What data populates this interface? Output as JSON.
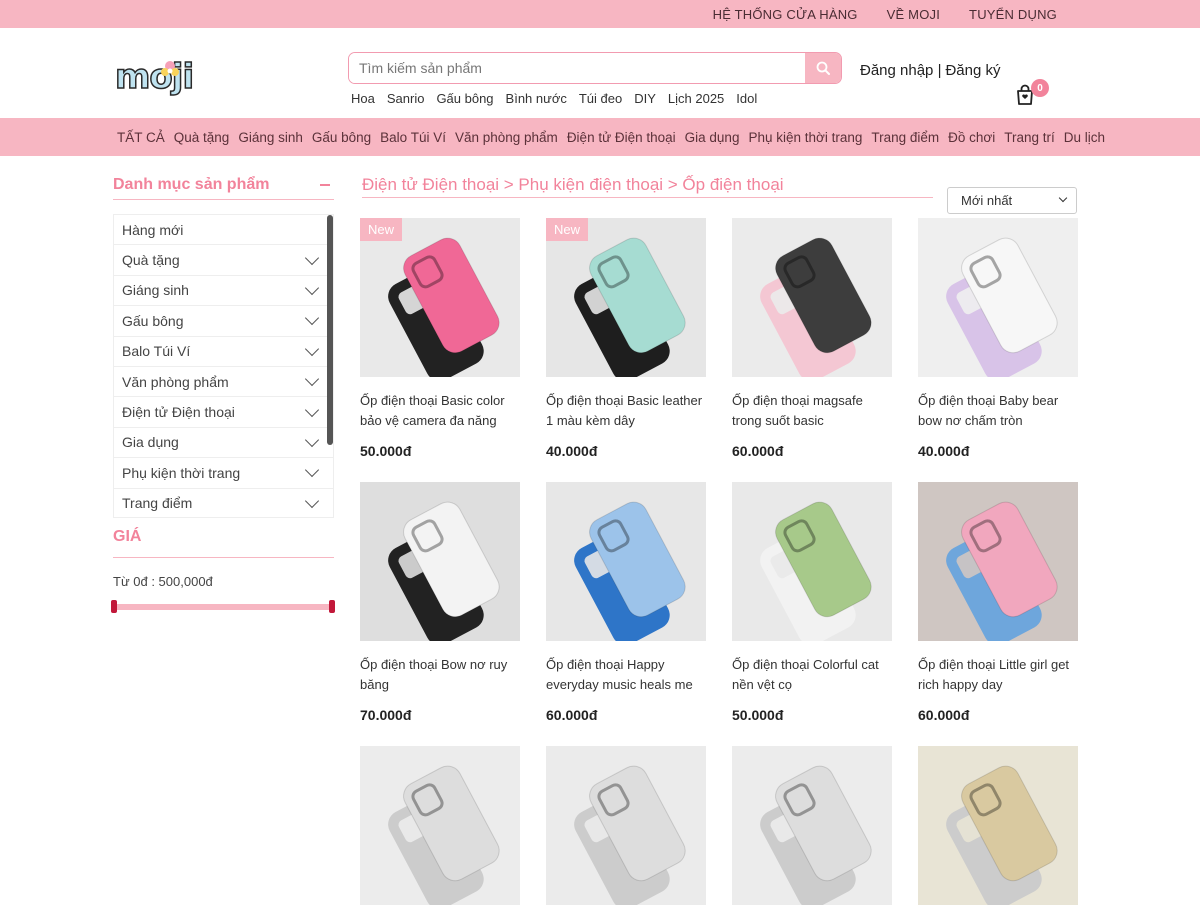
{
  "topbar": {
    "links": [
      "HỆ THỐNG CỬA HÀNG",
      "VỀ MOJI",
      "TUYỂN DỤNG"
    ]
  },
  "header": {
    "logo_text": "moji",
    "search_placeholder": "Tìm kiếm sản phẩm",
    "quick_tags": [
      "Hoa",
      "Sanrio",
      "Gấu bông",
      "Bình nước",
      "Túi đeo",
      "DIY",
      "Lịch 2025",
      "Idol"
    ],
    "login": "Đăng nhập |",
    "register": "Đăng ký",
    "cart_count": "0"
  },
  "catnav": [
    "TẤT CẢ",
    "Quà tặng",
    "Giáng sinh",
    "Gấu bông",
    "Balo Túi Ví",
    "Văn phòng phẩm",
    "Điện tử Điện thoại",
    "Gia dụng",
    "Phụ kiện thời trang",
    "Trang điểm",
    "Đồ chơi",
    "Trang trí",
    "Du lịch"
  ],
  "sidebar": {
    "title": "Danh mục sản phẩm",
    "items": [
      "Hàng mới",
      "Quà tặng",
      "Giáng sinh",
      "Gấu bông",
      "Balo Túi Ví",
      "Văn phòng phẩm",
      "Điện tử Điện thoại",
      "Gia dụng",
      "Phụ kiện thời trang",
      "Trang điểm"
    ],
    "price_title": "GIÁ",
    "price_range": "Từ 0đ : 500,000đ"
  },
  "breadcrumb": "Điện tử Điện thoại > Phụ kiện điện thoại > Ốp điện thoại",
  "sort": {
    "selected": "Mới nhất"
  },
  "badge_new": "New",
  "products": [
    {
      "name": "Ốp điện thoại Basic color bảo vệ camera đa năng",
      "price": "50.000đ",
      "is_new": true,
      "bg": "#e9e9e9",
      "case": "#f06896",
      "case2": "#222222"
    },
    {
      "name": "Ốp điện thoại Basic leather 1 màu kèm dây",
      "price": "40.000đ",
      "is_new": true,
      "bg": "#e6e6e6",
      "case": "#a6dcd2",
      "case2": "#1e1e1e"
    },
    {
      "name": "Ốp điện thoại magsafe trong suốt basic",
      "price": "60.000đ",
      "is_new": false,
      "bg": "#ebebeb",
      "case": "#3d3d3d",
      "case2": "#f4c7d3"
    },
    {
      "name": "Ốp điện thoại Baby bear bow nơ chấm tròn",
      "price": "40.000đ",
      "is_new": false,
      "bg": "#efefef",
      "case": "#f7f7f7",
      "case2": "#d8c3e8"
    },
    {
      "name": "Ốp điện thoại Bow nơ ruy băng",
      "price": "70.000đ",
      "is_new": false,
      "bg": "#dedede",
      "case": "#f3f3f3",
      "case2": "#222222"
    },
    {
      "name": "Ốp điện thoại Happy everyday music heals me",
      "price": "60.000đ",
      "is_new": false,
      "bg": "#e7e7e7",
      "case": "#9cc3ea",
      "case2": "#2e75c8"
    },
    {
      "name": "Ốp điện thoại Colorful cat nền vệt cọ",
      "price": "50.000đ",
      "is_new": false,
      "bg": "#e9e9e9",
      "case": "#a7c98a",
      "case2": "#f2f2f2"
    },
    {
      "name": "Ốp điện thoại Little girl get rich happy day",
      "price": "60.000đ",
      "is_new": false,
      "bg": "#cfc6c2",
      "case": "#f1a7be",
      "case2": "#6ea6dc"
    },
    {
      "name": "",
      "price": "",
      "is_new": false,
      "bg": "#ececec",
      "case": "#dddddd",
      "case2": "#cccccc"
    },
    {
      "name": "",
      "price": "",
      "is_new": false,
      "bg": "#ebebeb",
      "case": "#dddddd",
      "case2": "#cccccc"
    },
    {
      "name": "",
      "price": "",
      "is_new": false,
      "bg": "#ececec",
      "case": "#dddddd",
      "case2": "#cccccc"
    },
    {
      "name": "",
      "price": "",
      "is_new": false,
      "bg": "#e8e4d5",
      "case": "#d9c9a0",
      "case2": "#cccccc"
    }
  ],
  "colors": {
    "pink_bar": "#f7b6c2",
    "accent": "#f2839b",
    "dark_handle": "#c2183a"
  },
  "icons": {
    "search": "search-icon",
    "cart": "cart-icon",
    "chevron": "chevron-down-icon",
    "collapse": "minus-icon"
  }
}
